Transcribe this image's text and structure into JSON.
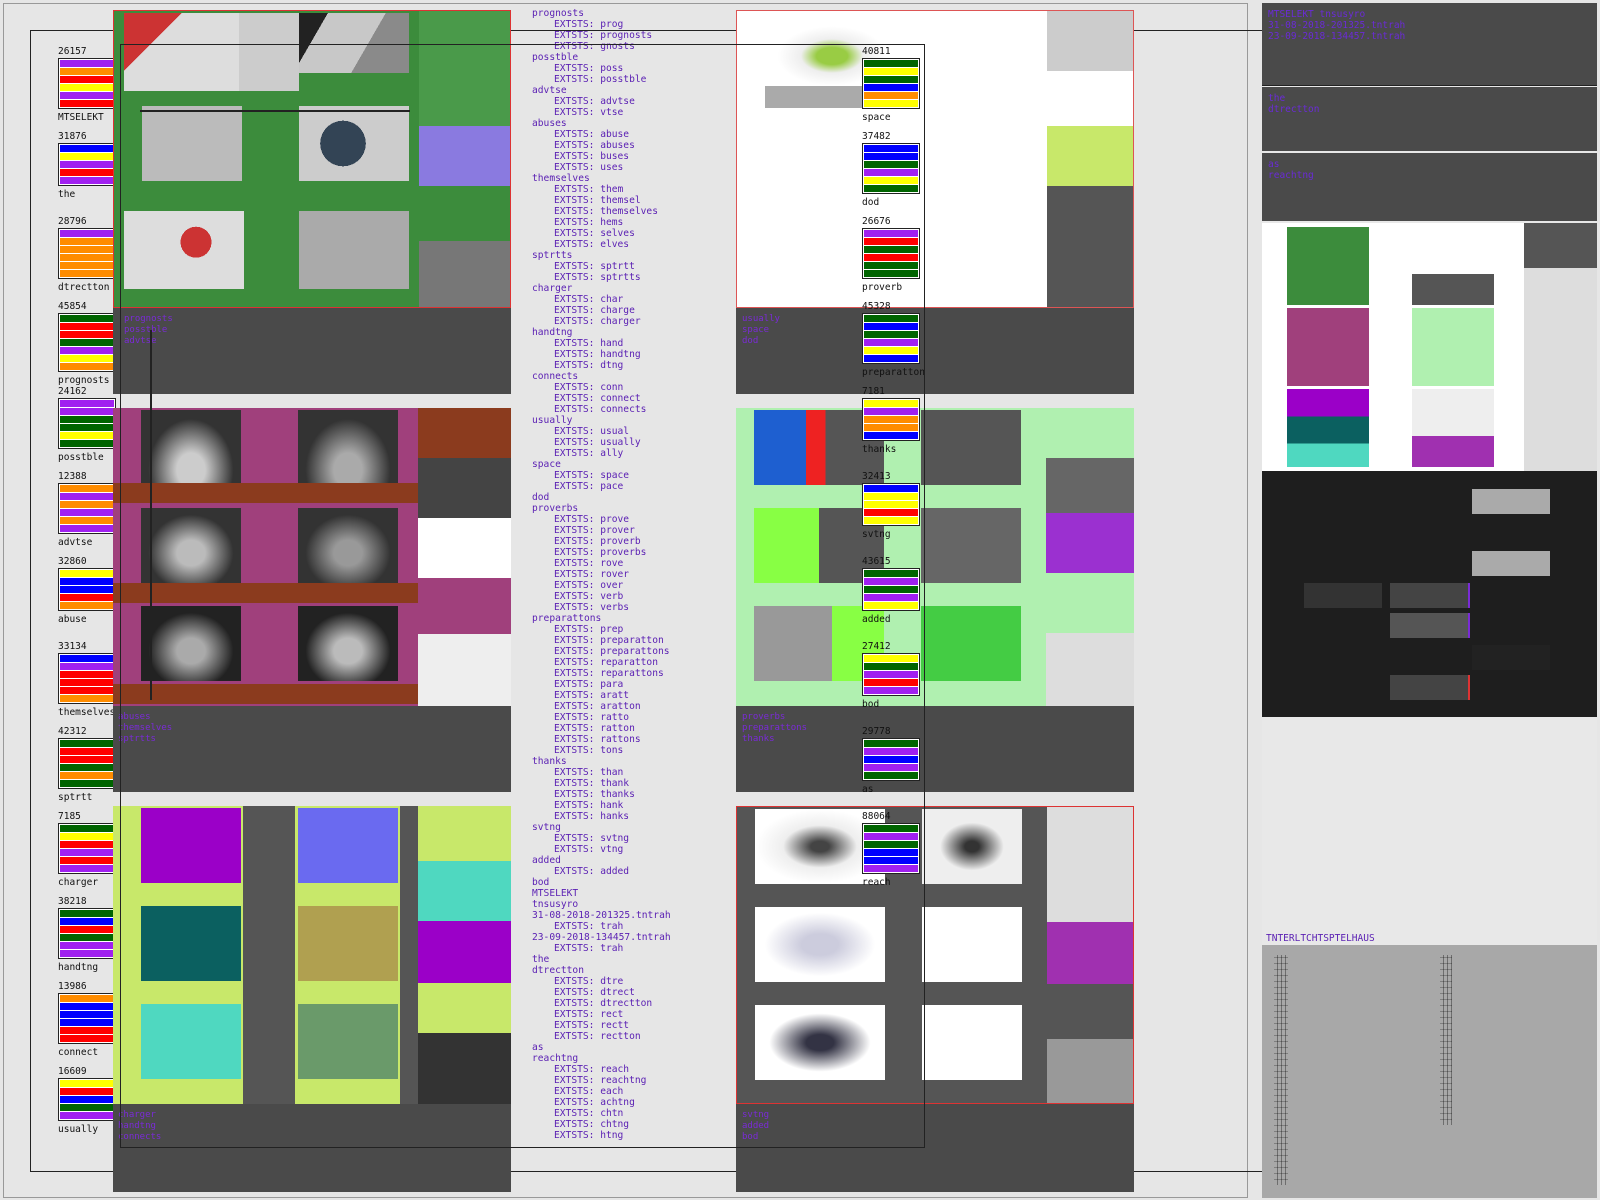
{
  "left_words": [
    {
      "count": "26157",
      "word": "MTSELEKT",
      "colors": [
        "#a020f0",
        "#ff8c00",
        "#ff0000",
        "#ffff00",
        "#a020f0",
        "#ff0000"
      ]
    },
    {
      "count": "31876",
      "word": "the",
      "colors": [
        "#0000ff",
        "#ffff00",
        "#a020f0",
        "#ff0000",
        "#a020f0"
      ]
    },
    {
      "count": "28796",
      "word": "dtrectton",
      "colors": [
        "#a020f0",
        "#ff8c00",
        "#ff8c00",
        "#ff8c00",
        "#ff8c00",
        "#ff8c00"
      ]
    },
    {
      "count": "45854",
      "word": "prognosts",
      "colors": [
        "#006400",
        "#ff0000",
        "#ff0000",
        "#006400",
        "#a020f0",
        "#ffff00",
        "#ff8c00"
      ]
    },
    {
      "count": "24162",
      "word": "posstble",
      "colors": [
        "#a020f0",
        "#a020f0",
        "#006400",
        "#006400",
        "#ffff00",
        "#006400"
      ]
    },
    {
      "count": "12388",
      "word": "advtse",
      "colors": [
        "#ff8c00",
        "#a020f0",
        "#ff8c00",
        "#a020f0",
        "#ff8c00",
        "#a020f0"
      ]
    },
    {
      "count": "32860",
      "word": "abuse",
      "colors": [
        "#ffff00",
        "#0000ff",
        "#0000ff",
        "#ff0000",
        "#ff8c00"
      ]
    },
    {
      "count": "33134",
      "word": "themselves",
      "colors": [
        "#0000ff",
        "#a020f0",
        "#ff0000",
        "#ff0000",
        "#ff0000",
        "#ff8c00"
      ]
    },
    {
      "count": "42312",
      "word": "sptrtt",
      "colors": [
        "#006400",
        "#ff0000",
        "#ff0000",
        "#006400",
        "#ff8c00",
        "#006400"
      ]
    },
    {
      "count": "7185",
      "word": "charger",
      "colors": [
        "#006400",
        "#ffff00",
        "#ff0000",
        "#a020f0",
        "#ff0000",
        "#a020f0"
      ]
    },
    {
      "count": "38218",
      "word": "handtng",
      "colors": [
        "#006400",
        "#0000ff",
        "#ff0000",
        "#006400",
        "#a020f0",
        "#a020f0"
      ]
    },
    {
      "count": "13986",
      "word": "connect",
      "colors": [
        "#ff8c00",
        "#0000ff",
        "#0000ff",
        "#0000ff",
        "#ff0000",
        "#ff0000"
      ]
    },
    {
      "count": "16609",
      "word": "usually",
      "colors": [
        "#ffff00",
        "#ff0000",
        "#0000ff",
        "#006400",
        "#a020f0"
      ]
    }
  ],
  "mid_words": [
    {
      "count": "40811",
      "word": "space",
      "colors": [
        "#006400",
        "#ffff00",
        "#006400",
        "#0000ff",
        "#ff8c00",
        "#ffff00"
      ]
    },
    {
      "count": "37482",
      "word": "dod",
      "colors": [
        "#0000ff",
        "#0000ff",
        "#006400",
        "#a020f0",
        "#ffff00",
        "#006400"
      ]
    },
    {
      "count": "26676",
      "word": "proverb",
      "colors": [
        "#a020f0",
        "#ff0000",
        "#006400",
        "#ff0000",
        "#006400",
        "#006400"
      ]
    },
    {
      "count": "45328",
      "word": "preparatton",
      "colors": [
        "#006400",
        "#0000ff",
        "#006400",
        "#a020f0",
        "#ffff00",
        "#0000ff"
      ]
    },
    {
      "count": "7181",
      "word": "thanks",
      "colors": [
        "#ffff00",
        "#a020f0",
        "#ff8c00",
        "#ff8c00",
        "#0000ff"
      ]
    },
    {
      "count": "32413",
      "word": "svtng",
      "colors": [
        "#0000ff",
        "#ffff00",
        "#ffff00",
        "#ff0000",
        "#ffff00"
      ]
    },
    {
      "count": "43615",
      "word": "added",
      "colors": [
        "#006400",
        "#a020f0",
        "#006400",
        "#a020f0",
        "#ffff00"
      ]
    },
    {
      "count": "27412",
      "word": "bod",
      "colors": [
        "#ffff00",
        "#006400",
        "#a020f0",
        "#ff0000",
        "#a020f0"
      ]
    },
    {
      "count": "29778",
      "word": "as",
      "colors": [
        "#006400",
        "#a020f0",
        "#0000ff",
        "#a020f0",
        "#006400"
      ]
    },
    {
      "count": "88064",
      "word": "reach",
      "colors": [
        "#006400",
        "#a020f0",
        "#006400",
        "#0000ff",
        "#0000ff",
        "#a020f0"
      ]
    }
  ],
  "panel_labels": {
    "p1": "prognosts\nposstble\nadvtse",
    "p2": "abuses\nthemselves\nsptrtts",
    "p3": "charger\nhandtng\nconnects",
    "p4": "usually\nspace\ndod",
    "p5": "proverbs\npreparattons\nthanks",
    "p6": "svtng\nadded\nbod"
  },
  "list": [
    {
      "t": "prognosts"
    },
    {
      "t": "EXTSTS: prog",
      "ex": true
    },
    {
      "t": "EXTSTS: prognosts",
      "ex": true
    },
    {
      "t": "EXTSTS: gnosts",
      "ex": true
    },
    {
      "t": "posstble"
    },
    {
      "t": "EXTSTS: poss",
      "ex": true
    },
    {
      "t": "EXTSTS: posstble",
      "ex": true
    },
    {
      "t": "advtse"
    },
    {
      "t": "EXTSTS: advtse",
      "ex": true
    },
    {
      "t": "EXTSTS: vtse",
      "ex": true
    },
    {
      "t": "abuses"
    },
    {
      "t": "EXTSTS: abuse",
      "ex": true
    },
    {
      "t": "EXTSTS: abuses",
      "ex": true
    },
    {
      "t": "EXTSTS: buses",
      "ex": true
    },
    {
      "t": "EXTSTS: uses",
      "ex": true
    },
    {
      "t": "themselves"
    },
    {
      "t": "EXTSTS: them",
      "ex": true
    },
    {
      "t": "EXTSTS: themsel",
      "ex": true
    },
    {
      "t": "EXTSTS: themselves",
      "ex": true
    },
    {
      "t": "EXTSTS: hems",
      "ex": true
    },
    {
      "t": "EXTSTS: selves",
      "ex": true
    },
    {
      "t": "EXTSTS: elves",
      "ex": true
    },
    {
      "t": "sptrtts"
    },
    {
      "t": "EXTSTS: sptrtt",
      "ex": true
    },
    {
      "t": "EXTSTS: sptrtts",
      "ex": true
    },
    {
      "t": "charger"
    },
    {
      "t": "EXTSTS: char",
      "ex": true
    },
    {
      "t": "EXTSTS: charge",
      "ex": true
    },
    {
      "t": "EXTSTS: charger",
      "ex": true
    },
    {
      "t": "handtng"
    },
    {
      "t": "EXTSTS: hand",
      "ex": true
    },
    {
      "t": "EXTSTS: handtng",
      "ex": true
    },
    {
      "t": "EXTSTS: dtng",
      "ex": true
    },
    {
      "t": "connects"
    },
    {
      "t": "EXTSTS: conn",
      "ex": true
    },
    {
      "t": "EXTSTS: connect",
      "ex": true
    },
    {
      "t": "EXTSTS: connects",
      "ex": true
    },
    {
      "t": "usually"
    },
    {
      "t": "EXTSTS: usual",
      "ex": true
    },
    {
      "t": "EXTSTS: usually",
      "ex": true
    },
    {
      "t": "EXTSTS: ally",
      "ex": true
    },
    {
      "t": "space"
    },
    {
      "t": "EXTSTS: space",
      "ex": true
    },
    {
      "t": "EXTSTS: pace",
      "ex": true
    },
    {
      "t": "dod"
    },
    {
      "t": "proverbs"
    },
    {
      "t": "EXTSTS: prove",
      "ex": true
    },
    {
      "t": "EXTSTS: prover",
      "ex": true
    },
    {
      "t": "EXTSTS: proverb",
      "ex": true
    },
    {
      "t": "EXTSTS: proverbs",
      "ex": true
    },
    {
      "t": "EXTSTS: rove",
      "ex": true
    },
    {
      "t": "EXTSTS: rover",
      "ex": true
    },
    {
      "t": "EXTSTS: over",
      "ex": true
    },
    {
      "t": "EXTSTS: verb",
      "ex": true
    },
    {
      "t": "EXTSTS: verbs",
      "ex": true
    },
    {
      "t": "preparattons"
    },
    {
      "t": "EXTSTS: prep",
      "ex": true
    },
    {
      "t": "EXTSTS: preparatton",
      "ex": true
    },
    {
      "t": "EXTSTS: preparattons",
      "ex": true
    },
    {
      "t": "EXTSTS: reparatton",
      "ex": true
    },
    {
      "t": "EXTSTS: reparattons",
      "ex": true
    },
    {
      "t": "EXTSTS: para",
      "ex": true
    },
    {
      "t": "EXTSTS: aratt",
      "ex": true
    },
    {
      "t": "EXTSTS: aratton",
      "ex": true
    },
    {
      "t": "EXTSTS: ratto",
      "ex": true
    },
    {
      "t": "EXTSTS: ratton",
      "ex": true
    },
    {
      "t": "EXTSTS: rattons",
      "ex": true
    },
    {
      "t": "EXTSTS: tons",
      "ex": true
    },
    {
      "t": "thanks"
    },
    {
      "t": "EXTSTS: than",
      "ex": true
    },
    {
      "t": "EXTSTS: thank",
      "ex": true
    },
    {
      "t": "EXTSTS: thanks",
      "ex": true
    },
    {
      "t": "EXTSTS: hank",
      "ex": true
    },
    {
      "t": "EXTSTS: hanks",
      "ex": true
    },
    {
      "t": "svtng"
    },
    {
      "t": "EXTSTS: svtng",
      "ex": true
    },
    {
      "t": "EXTSTS: vtng",
      "ex": true
    },
    {
      "t": "added"
    },
    {
      "t": "EXTSTS: added",
      "ex": true
    },
    {
      "t": "bod"
    },
    {
      "t": "MTSELEKT"
    },
    {
      "t": "tnsusyro"
    },
    {
      "t": "31-08-2018-201325.tntrah"
    },
    {
      "t": "EXTSTS: trah",
      "ex": true
    },
    {
      "t": "23-09-2018-134457.tntrah"
    },
    {
      "t": "EXTSTS: trah",
      "ex": true
    },
    {
      "t": "the"
    },
    {
      "t": "dtrectton"
    },
    {
      "t": "EXTSTS: dtre",
      "ex": true
    },
    {
      "t": "EXTSTS: dtrect",
      "ex": true
    },
    {
      "t": "EXTSTS: dtrectton",
      "ex": true
    },
    {
      "t": "EXTSTS: rect",
      "ex": true
    },
    {
      "t": "EXTSTS: rectt",
      "ex": true
    },
    {
      "t": "EXTSTS: rectton",
      "ex": true
    },
    {
      "t": "as"
    },
    {
      "t": "reachtng"
    },
    {
      "t": "EXTSTS: reach",
      "ex": true
    },
    {
      "t": "EXTSTS: reachtng",
      "ex": true
    },
    {
      "t": "EXTSTS: each",
      "ex": true
    },
    {
      "t": "EXTSTS: achtng",
      "ex": true
    },
    {
      "t": "EXTSTS: chtn",
      "ex": true
    },
    {
      "t": "EXTSTS: chtng",
      "ex": true
    },
    {
      "t": "EXTSTS: htng",
      "ex": true
    }
  ],
  "right_panel": {
    "header": "MTSELEKT tnsusyro\n31-08-2018-201325.tntrah\n23-09-2018-134457.tntrah",
    "block2": "the\ndtrectton",
    "block3": "as\nreachtng",
    "footer_title": "TNTERLTCHTSPTELHAUS"
  },
  "colors": {
    "green": "#3c8c3c",
    "magenta": "#a0407c",
    "lime": "#c8e86a",
    "light_green": "#b0f0b0",
    "violet": "#9b30d0",
    "dark": "#4a4a4a",
    "label": "#7a2bd6"
  }
}
